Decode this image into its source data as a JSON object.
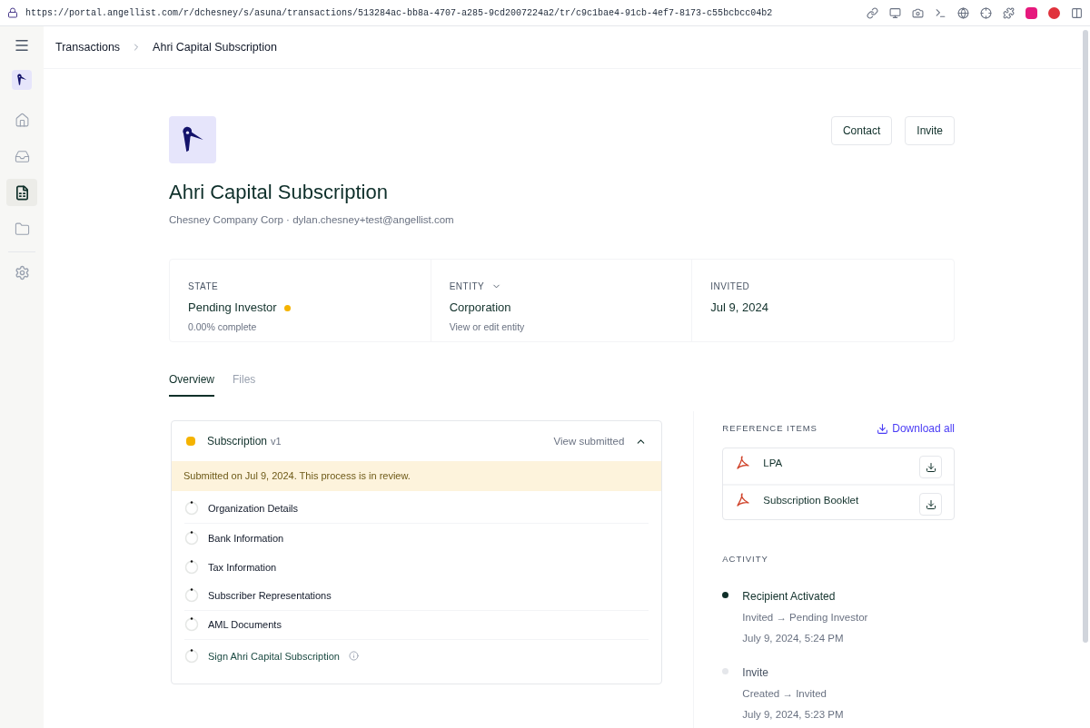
{
  "browser": {
    "url": "https://portal.angellist.com/r/dchesney/s/asuna/transactions/513284ac-bb8a-4707-a285-9cd2007224a2/tr/c9c1bae4-91cb-4ef7-8173-c55bcbcc04b2"
  },
  "sidebar": {
    "items": [
      {
        "kind": "home",
        "selected": false
      },
      {
        "kind": "inbox",
        "selected": false
      },
      {
        "kind": "ledger",
        "selected": true
      },
      {
        "kind": "folder",
        "selected": false
      }
    ]
  },
  "breadcrumb": [
    "Transactions",
    "Ahri Capital Subscription"
  ],
  "header": {
    "title": "Ahri Capital Subscription",
    "subtitle": "Chesney Company Corp · dylan.chesney+test@angellist.com",
    "buttons": [
      "Contact",
      "Invite"
    ]
  },
  "summary": [
    {
      "label": "STATE",
      "value": "Pending Investor",
      "note": "0.00% complete",
      "color": "#f5b300",
      "dropdown": false
    },
    {
      "label": "ENTITY",
      "value": "Corporation",
      "note": "View or edit entity",
      "dropdown": true
    },
    {
      "label": "INVITED",
      "value": "Jul 9, 2024",
      "dropdown": false
    }
  ],
  "tabs": [
    {
      "label": "Overview",
      "selected": true
    },
    {
      "label": "Files",
      "selected": false
    }
  ],
  "subscription": {
    "title": "Subscription",
    "version": "v1",
    "color": "#f5b300",
    "action": "View submitted",
    "expanded": true,
    "notice": "Submitted on Jul 9, 2024. This process is in review.",
    "steps": [
      {
        "label": "Organization Details",
        "kind": "task"
      },
      {
        "label": "Bank Information",
        "kind": "task"
      },
      {
        "label": "Tax Information",
        "kind": "task"
      },
      {
        "label": "Subscriber Representations",
        "kind": "task"
      },
      {
        "label": "AML Documents",
        "kind": "task"
      },
      {
        "label": "Sign Ahri Capital Subscription",
        "kind": "signature"
      }
    ]
  },
  "reference_items": {
    "title": "REFERENCE ITEMS",
    "action": "Download all",
    "items": [
      "LPA",
      "Subscription Booklet"
    ]
  },
  "activity": {
    "title": "ACTIVITY",
    "items": [
      {
        "title": "Recipient Activated",
        "change": "Invited → Pending Investor",
        "time": "July 9, 2024, 5:24 PM",
        "current": true
      },
      {
        "title": "Invite",
        "change": "Created → Invited",
        "time": "July 9, 2024, 5:23 PM",
        "current": false
      }
    ]
  }
}
